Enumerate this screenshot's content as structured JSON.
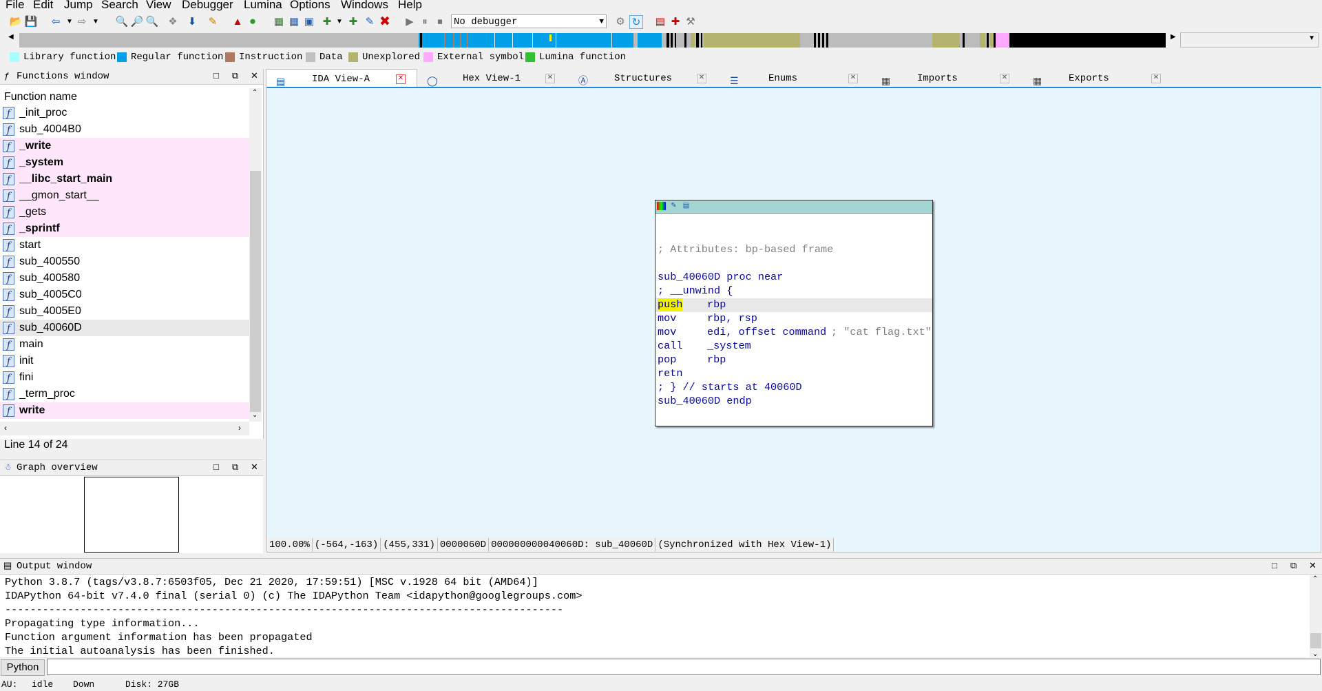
{
  "menu": [
    "File",
    "Edit",
    "Jump",
    "Search",
    "View",
    "Debugger",
    "Lumina",
    "Options",
    "Windows",
    "Help"
  ],
  "toolbar": {
    "debugger_select": "No debugger"
  },
  "legend": [
    {
      "label": "Library function",
      "color": "#a8ffff"
    },
    {
      "label": "Regular function",
      "color": "#00a0e8"
    },
    {
      "label": "Instruction",
      "color": "#b07860"
    },
    {
      "label": "Data",
      "color": "#c0c0c0"
    },
    {
      "label": "Unexplored",
      "color": "#b4b470"
    },
    {
      "label": "External symbol",
      "color": "#ffaaff"
    },
    {
      "label": "Lumina function",
      "color": "#30c030"
    }
  ],
  "functions_window": {
    "title": "Functions window",
    "header": "Function name",
    "items": [
      {
        "name": "_init_proc",
        "style": "normal"
      },
      {
        "name": "sub_4004B0",
        "style": "normal"
      },
      {
        "name": "_write",
        "style": "external"
      },
      {
        "name": "_system",
        "style": "external"
      },
      {
        "name": "__libc_start_main",
        "style": "external"
      },
      {
        "name": "__gmon_start__",
        "style": "external-plain"
      },
      {
        "name": "_gets",
        "style": "external-plain"
      },
      {
        "name": "_sprintf",
        "style": "external"
      },
      {
        "name": "start",
        "style": "normal"
      },
      {
        "name": "sub_400550",
        "style": "normal"
      },
      {
        "name": "sub_400580",
        "style": "normal"
      },
      {
        "name": "sub_4005C0",
        "style": "normal"
      },
      {
        "name": "sub_4005E0",
        "style": "normal"
      },
      {
        "name": "sub_40060D",
        "style": "selected"
      },
      {
        "name": "main",
        "style": "normal"
      },
      {
        "name": "init",
        "style": "normal"
      },
      {
        "name": "fini",
        "style": "normal"
      },
      {
        "name": "_term_proc",
        "style": "normal"
      },
      {
        "name": "write",
        "style": "external"
      }
    ],
    "line_status": "Line 14 of 24"
  },
  "graph_overview": {
    "title": "Graph overview"
  },
  "tabs": [
    {
      "label": "IDA View-A",
      "active": true
    },
    {
      "label": "Hex View-1",
      "active": false
    },
    {
      "label": "Structures",
      "active": false
    },
    {
      "label": "Enums",
      "active": false
    },
    {
      "label": "Imports",
      "active": false
    },
    {
      "label": "Exports",
      "active": false
    }
  ],
  "code": {
    "comment_attr": "; Attributes: bp-based frame",
    "proc_line": "sub_40060D proc near",
    "unwind": "; __unwind {",
    "lines": [
      {
        "mnem": "push",
        "ops": "rbp",
        "cmt": ""
      },
      {
        "mnem": "mov",
        "ops": "rbp, rsp",
        "cmt": ""
      },
      {
        "mnem": "mov",
        "ops": "edi, offset command",
        "cmt": "; \"cat flag.txt\""
      },
      {
        "mnem": "call",
        "ops": "_system",
        "cmt": ""
      },
      {
        "mnem": "pop",
        "ops": "rbp",
        "cmt": ""
      },
      {
        "mnem": "retn",
        "ops": "",
        "cmt": ""
      }
    ],
    "end_comment": "; } // starts at 40060D",
    "endp_line": "sub_40060D endp"
  },
  "graph_status": [
    "100.00%",
    "(-564,-163)",
    "(455,331)",
    "0000060D",
    "000000000040060D: sub_40060D",
    "(Synchronized with Hex View-1)"
  ],
  "output_window": {
    "title": "Output window",
    "lines": [
      "Python 3.8.7 (tags/v3.8.7:6503f05, Dec 21 2020, 17:59:51) [MSC v.1928 64 bit (AMD64)]",
      "IDAPython 64-bit v7.4.0 final (serial 0) (c) The IDAPython Team <idapython@googlegroups.com>",
      "-----------------------------------------------------------------------------------------",
      "Propagating type information...",
      "Function argument information has been propagated",
      "The initial autoanalysis has been finished."
    ]
  },
  "python_button": "Python",
  "bottom_status": {
    "au": "AU:",
    "state": "idle",
    "direction": "Down",
    "disk": "Disk: 27GB"
  }
}
